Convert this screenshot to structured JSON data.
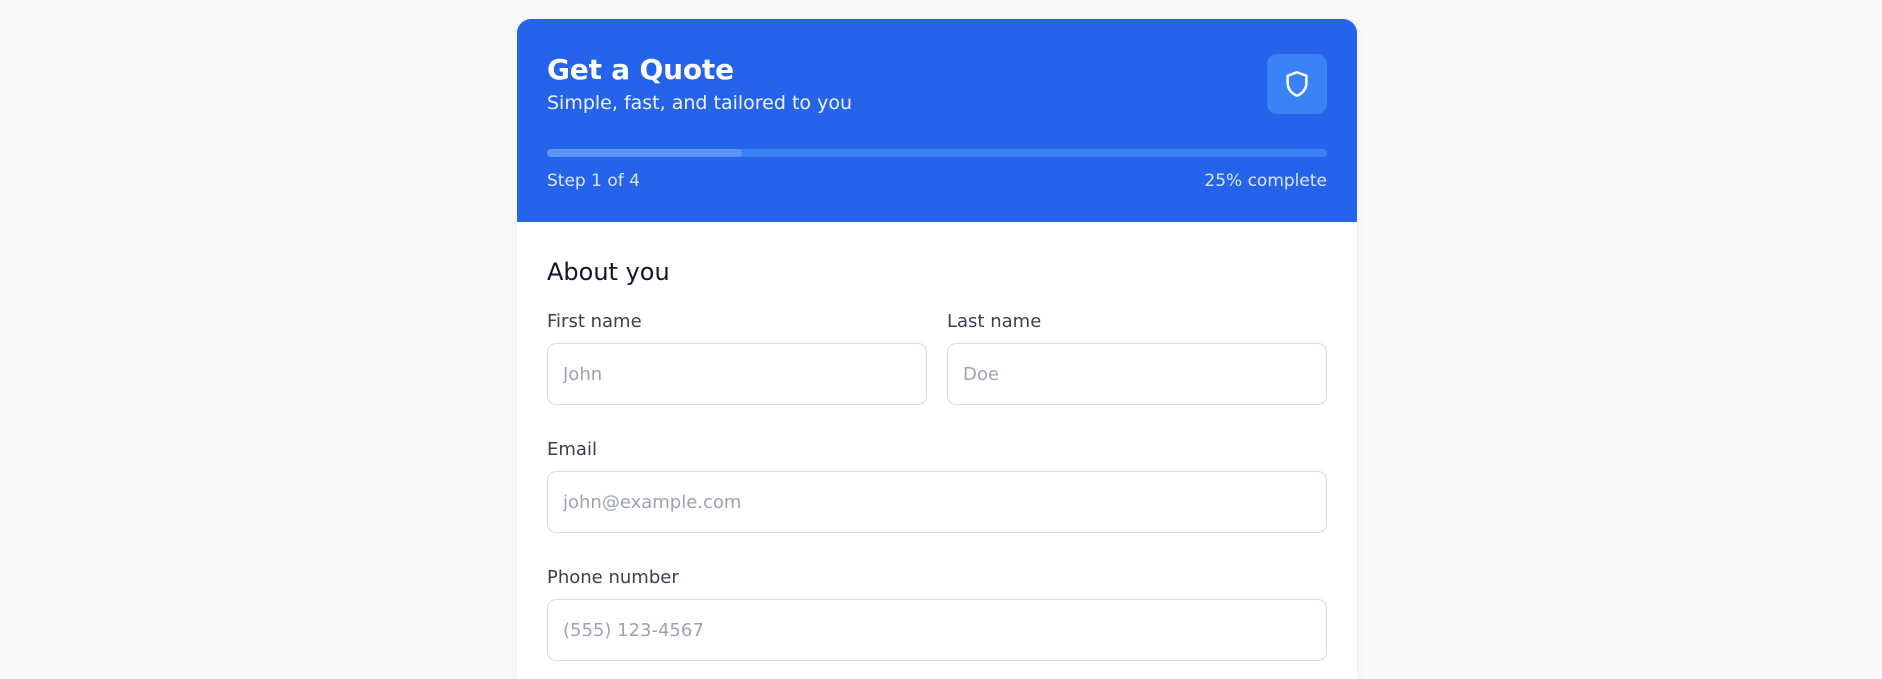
{
  "header": {
    "title": "Get a Quote",
    "subtitle": "Simple, fast, and tailored to you",
    "icon": "shield-icon",
    "step_text": "Step 1 of 4",
    "complete_text": "25% complete",
    "progress_fraction": 0.25
  },
  "colors": {
    "header_bg": "#2563eb",
    "accent": "#3b82f6"
  },
  "form": {
    "section_title": "About you",
    "first_name": {
      "label": "First name",
      "placeholder": "John",
      "value": ""
    },
    "last_name": {
      "label": "Last name",
      "placeholder": "Doe",
      "value": ""
    },
    "email": {
      "label": "Email",
      "placeholder": "john@example.com",
      "value": ""
    },
    "phone": {
      "label": "Phone number",
      "placeholder": "(555) 123-4567",
      "value": ""
    }
  }
}
